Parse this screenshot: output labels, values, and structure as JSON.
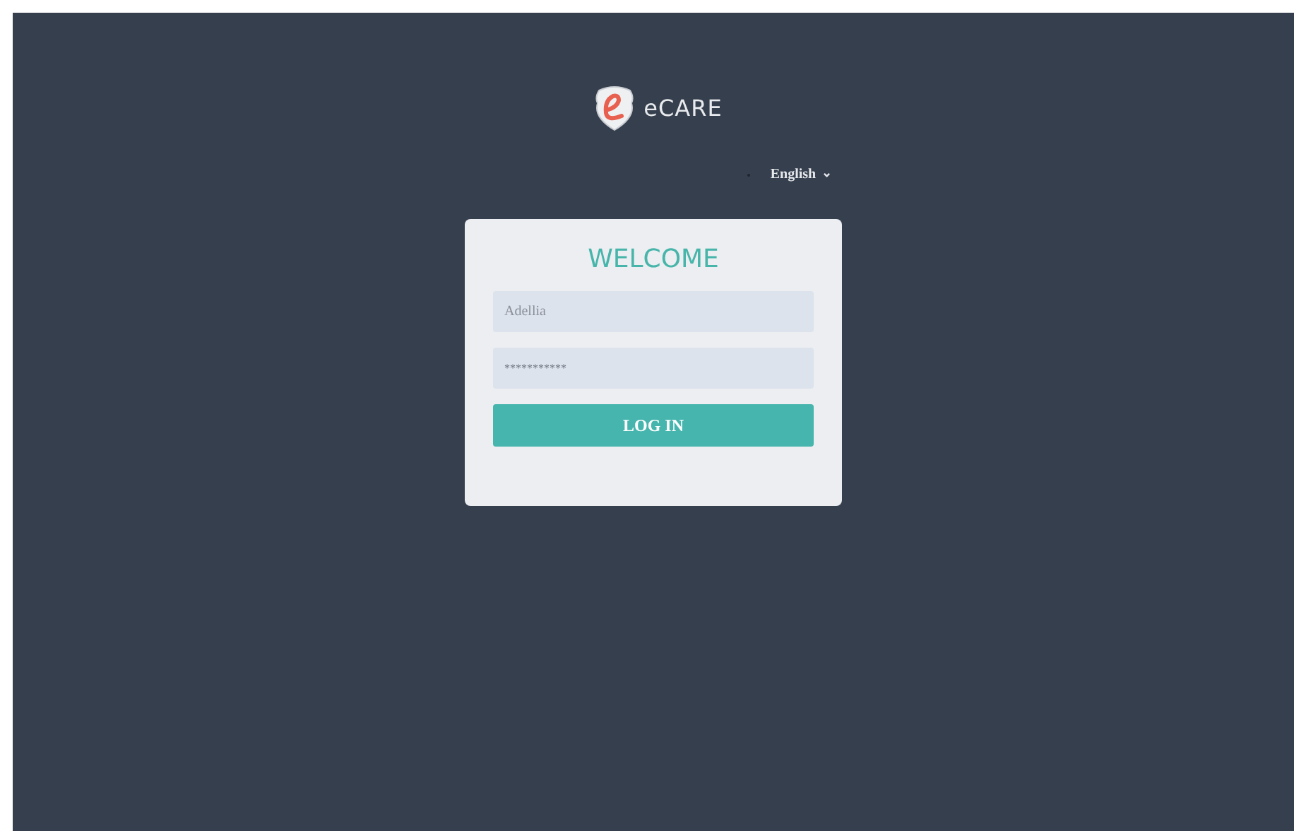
{
  "logo": {
    "text": "eCARE"
  },
  "language": {
    "label": "English",
    "arrow": "⌄"
  },
  "login": {
    "title": "WELCOME",
    "fields": [
      {
        "kind": "text",
        "value": "Adellia"
      },
      {
        "kind": "password",
        "value": "***********"
      }
    ],
    "button": "LOG IN"
  }
}
